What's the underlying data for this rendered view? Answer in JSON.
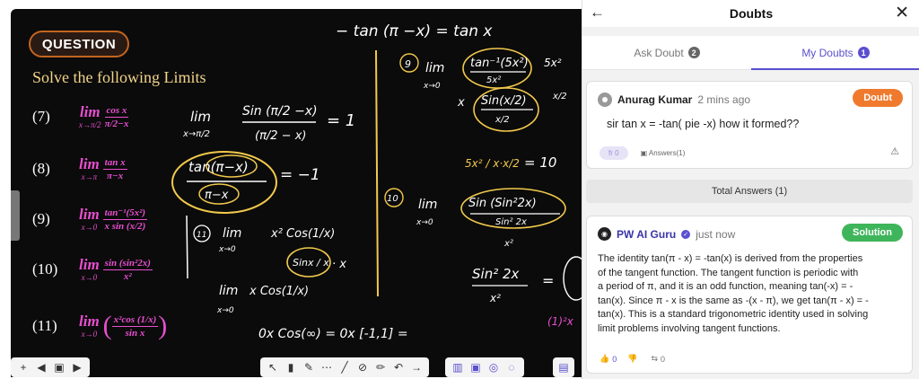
{
  "board": {
    "badge": "QUESTION",
    "title": "Solve the following Limits",
    "problems": [
      {
        "num": "(7)",
        "lim": "lim",
        "sub": "x→π/2",
        "numer": "cos x",
        "denom": "π/2−x"
      },
      {
        "num": "(8)",
        "lim": "lim",
        "sub": "x→π",
        "numer": "tan x",
        "denom": "π−x"
      },
      {
        "num": "(9)",
        "lim": "lim",
        "sub": "x→0",
        "numer": "tan⁻¹(5x²)",
        "denom": "x sin (x/2)"
      },
      {
        "num": "(10)",
        "lim": "lim",
        "sub": "x→0",
        "numer": "sin (sin²2x)",
        "denom": "x²"
      },
      {
        "num": "(11)",
        "lim": "lim",
        "sub": "x→0",
        "numer": "x²cos (1/x)",
        "denom": "sin x"
      }
    ],
    "ink": {
      "top": "− tan (π −x) =  tan x",
      "p7_lim": "lim",
      "p7_sub": "x→π/2",
      "p7_num": "Sin (π/2 −x)",
      "p7_den": "(π/2 − x)",
      "p7_res": "= 1",
      "p8_num": "tan(π−x)",
      "p8_den": "π−x",
      "p8_res": "= −1",
      "p11_label": "11",
      "p11_lim": "lim",
      "p11_sub": "x→0",
      "p11_expr": "x² Cos(1/x)",
      "p11_frac": "Sinx / x",
      "p11_x": "· x",
      "p11_lim2": "lim",
      "p11_sub2": "x→0",
      "p11_expr2": "x Cos(1/x)",
      "p11_last": "0x Cos(∞) = 0x [-1,1] =",
      "p9_label": "9",
      "p9_lim": "lim",
      "p9_sub": "x→0",
      "p9_num": "tan⁻¹(5x²)",
      "p9_den": "5x²",
      "p9_mult": "5x²",
      "p9_x": "x",
      "p9_sin": "Sin(x/2)",
      "p9_sin_den": "x/2",
      "p9_x2": "x/2",
      "p9_frac": "5x² / x·x/2",
      "p9_res": "= 10",
      "p10_label": "10",
      "p10_lim": "lim",
      "p10_sub": "x→0",
      "p10_num": "Sin (Sin²2x)",
      "p10_den": "Sin² 2x",
      "p10_den2": "x²",
      "p10_b": "Sin² 2x",
      "p10_b_den": "x²",
      "p10_eq": "=",
      "p10_tail": "(1)²x"
    }
  },
  "toolbar": {
    "left": [
      "+",
      "◀",
      "▣",
      "▶"
    ],
    "middle": [
      "↖",
      "▮",
      "✎",
      "⋯",
      "╱",
      "⊘",
      "✏",
      "↶",
      "→"
    ],
    "right": [
      "▥",
      "▣",
      "◎",
      "◌"
    ],
    "far": [
      "▤"
    ]
  },
  "panel": {
    "title": "Doubts",
    "back_icon": "arrow-left-icon",
    "close_icon": "close-icon",
    "tabs": [
      {
        "label": "Ask Doubt",
        "count": "2",
        "count_color": "#666666"
      },
      {
        "label": "My Doubts",
        "count": "1",
        "count_color": "#5a4fcf"
      }
    ],
    "doubt": {
      "author": "Anurag Kumar",
      "time": "2 mins ago",
      "badge": "Doubt",
      "badge_color": "#ef7a2e",
      "text": "sir tan x = -tan( pie -x) how it formed??",
      "fr": "fr 0",
      "answers": "Answers(1)"
    },
    "total": "Total Answers (1)",
    "answer": {
      "author": "PW AI Guru",
      "time": "just now",
      "badge": "Solution",
      "badge_color": "#3fb55b",
      "lines": [
        "The identity tan(π - x) = -tan(x) is derived from the properties",
        "of the tangent function. The tangent function is periodic with",
        "a period of π, and it is an odd function, meaning tan(-x) = -",
        "tan(x). Since π - x is the same as -(x - π), we get tan(π - x) = -",
        "tan(x). This is a standard trigonometric identity used in solving",
        "limit problems involving tangent functions."
      ],
      "likes": "0",
      "dislikes": "",
      "shares": "0"
    }
  }
}
